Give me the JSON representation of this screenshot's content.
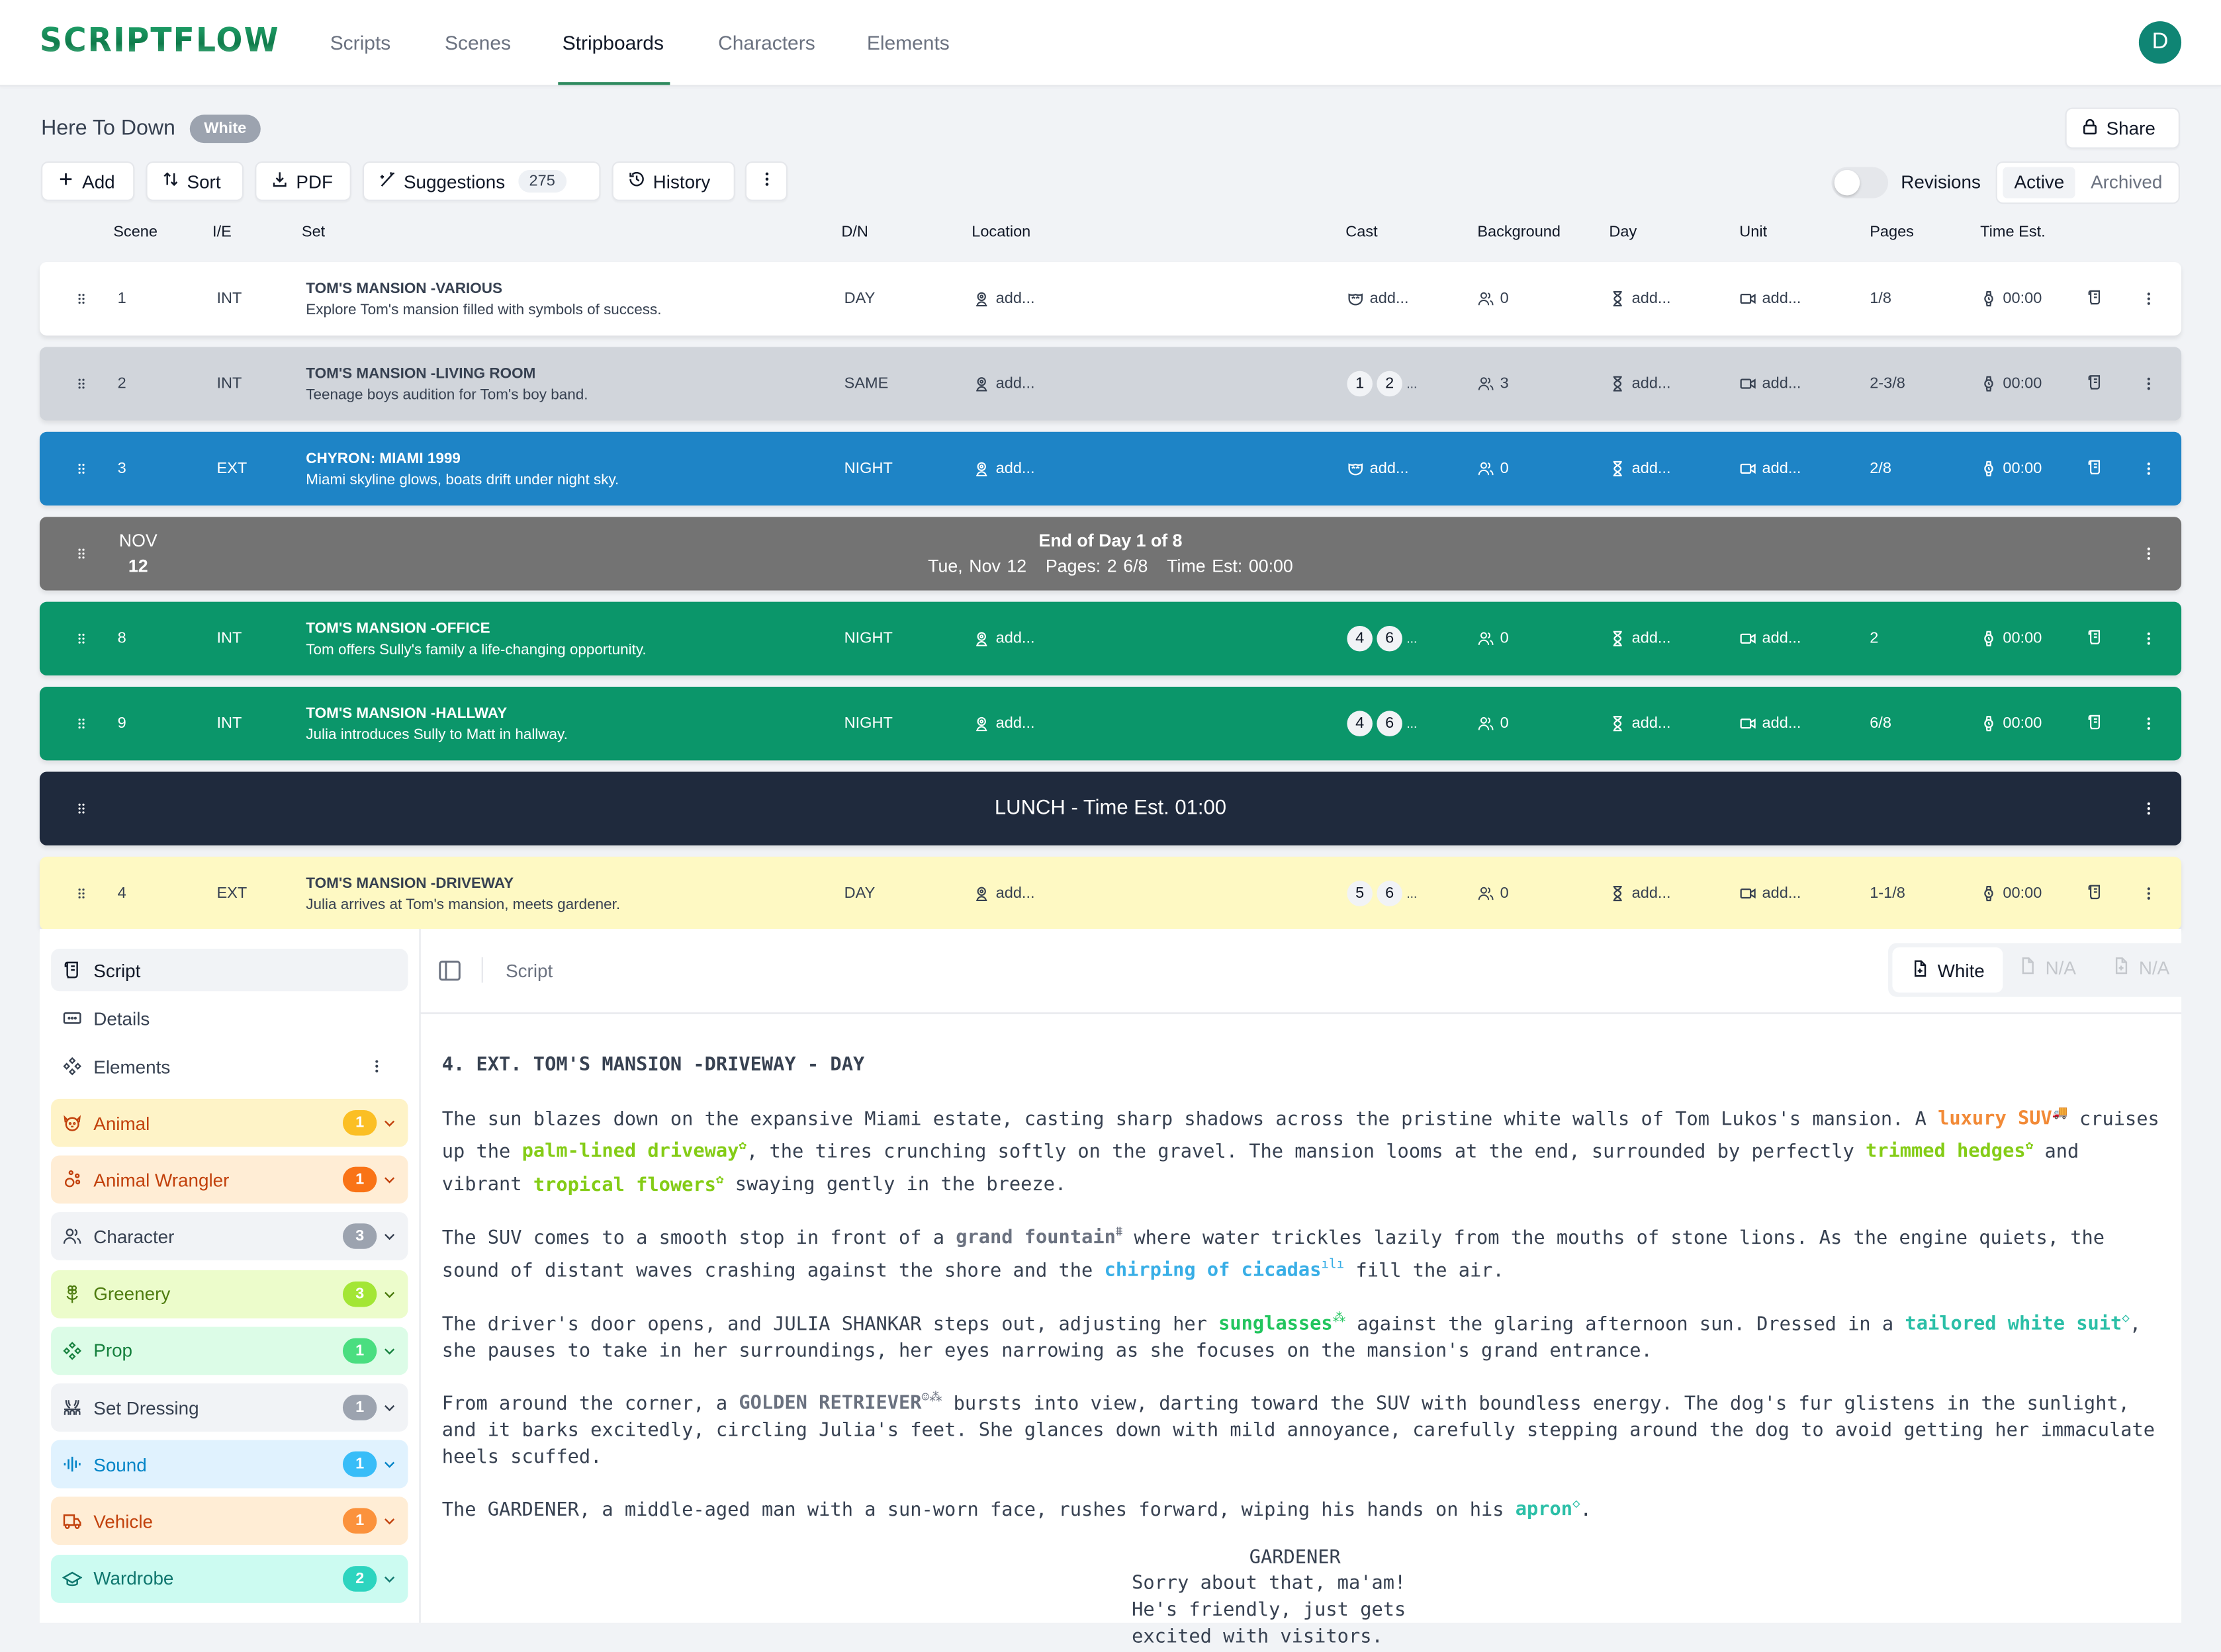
{
  "app": {
    "logo": "SCRIPTFLOW",
    "nav": [
      "Scripts",
      "Scenes",
      "Stripboards",
      "Characters",
      "Elements"
    ],
    "active_nav": "Stripboards",
    "avatar_initial": "D"
  },
  "header": {
    "title": "Here To Down",
    "revision_badge": "White",
    "share_label": "Share",
    "toolbar": {
      "add": "Add",
      "sort": "Sort",
      "pdf": "PDF",
      "suggestions": "Suggestions",
      "suggestions_count": "275",
      "history": "History"
    },
    "revisions_label": "Revisions",
    "revisions_on": false,
    "view_options": [
      "Active",
      "Archived"
    ],
    "active_view": "Active"
  },
  "table": {
    "columns": [
      "Scene",
      "I/E",
      "Set",
      "D/N",
      "Location",
      "Cast",
      "Background",
      "Day",
      "Unit",
      "Pages",
      "Time Est."
    ],
    "rows": [
      {
        "type": "scene",
        "scene": "1",
        "ie": "INT",
        "set": "TOM'S MANSION -VARIOUS",
        "desc": "Explore Tom's mansion filled with symbols of success.",
        "dn": "DAY",
        "location": "add...",
        "cast": [],
        "cast_placeholder": "add...",
        "background": "0",
        "day": "add...",
        "unit": "add...",
        "pages": "1/8",
        "time": "00:00",
        "color": "#ffffff",
        "text": "#374151"
      },
      {
        "type": "scene",
        "scene": "2",
        "ie": "INT",
        "set": "TOM'S MANSION -LIVING ROOM",
        "desc": "Teenage boys audition for Tom's boy band.",
        "dn": "SAME",
        "location": "add...",
        "cast": [
          "1",
          "2"
        ],
        "cast_more": "...",
        "background": "3",
        "day": "add...",
        "unit": "add...",
        "pages": "2-3/8",
        "time": "00:00",
        "color": "#d1d5db",
        "text": "#374151"
      },
      {
        "type": "scene",
        "scene": "3",
        "ie": "EXT",
        "set": "CHYRON: MIAMI 1999",
        "desc": "Miami skyline glows, boats drift under night sky.",
        "dn": "NIGHT",
        "location": "add...",
        "cast": [],
        "cast_placeholder": "add...",
        "background": "0",
        "day": "add...",
        "unit": "add...",
        "pages": "2/8",
        "time": "00:00",
        "color": "#1e84c6",
        "text": "#ffffff"
      },
      {
        "type": "day_break",
        "month": "NOV",
        "day": "12",
        "title": "End of Day 1 of 8",
        "date": "Tue, Nov 12",
        "pages": "Pages: 2 6/8",
        "time": "Time Est: 00:00",
        "color": "#737373",
        "text": "#ffffff"
      },
      {
        "type": "scene",
        "scene": "8",
        "ie": "INT",
        "set": "TOM'S MANSION -OFFICE",
        "desc": "Tom offers Sully's family a life-changing opportunity.",
        "dn": "NIGHT",
        "location": "add...",
        "cast": [
          "4",
          "6"
        ],
        "cast_more": "...",
        "background": "0",
        "day": "add...",
        "unit": "add...",
        "pages": "2",
        "time": "00:00",
        "color": "#0b966a",
        "text": "#ffffff"
      },
      {
        "type": "scene",
        "scene": "9",
        "ie": "INT",
        "set": "TOM'S MANSION -HALLWAY",
        "desc": "Julia introduces Sully to Matt in hallway.",
        "dn": "NIGHT",
        "location": "add...",
        "cast": [
          "4",
          "6"
        ],
        "cast_more": "...",
        "background": "0",
        "day": "add...",
        "unit": "add...",
        "pages": "6/8",
        "time": "00:00",
        "color": "#0b966a",
        "text": "#ffffff"
      },
      {
        "type": "banner",
        "title": "LUNCH - Time Est. 01:00",
        "color": "#1f2a3d",
        "text": "#ffffff"
      },
      {
        "type": "scene",
        "scene": "4",
        "ie": "EXT",
        "set": "TOM'S MANSION -DRIVEWAY",
        "desc": "Julia arrives at Tom's mansion, meets gardener.",
        "dn": "DAY",
        "location": "add...",
        "cast": [
          "5",
          "6"
        ],
        "cast_more": "...",
        "background": "0",
        "day": "add...",
        "unit": "add...",
        "pages": "1-1/8",
        "time": "00:00",
        "color": "#fef9c3",
        "text": "#374151"
      }
    ]
  },
  "sidebar": {
    "nav": [
      {
        "label": "Script",
        "icon": "script-icon",
        "active": true
      },
      {
        "label": "Details",
        "icon": "details-icon",
        "active": false
      },
      {
        "label": "Elements",
        "icon": "elements-icon",
        "active": false
      }
    ],
    "categories": [
      {
        "label": "Animal",
        "count": "1",
        "icon": "animal-icon",
        "bg": "#fef3c7",
        "fg": "#c2410c",
        "badge": "#fbbf24"
      },
      {
        "label": "Animal Wrangler",
        "count": "1",
        "icon": "paw-icon",
        "bg": "#ffedd5",
        "fg": "#c2410c",
        "badge": "#f97316"
      },
      {
        "label": "Character",
        "count": "3",
        "icon": "users-icon",
        "bg": "#f1f3f6",
        "fg": "#374151",
        "badge": "#9ca3af"
      },
      {
        "label": "Greenery",
        "count": "3",
        "icon": "flower-icon",
        "bg": "#ecfccb",
        "fg": "#4d7c0f",
        "badge": "#a3e635"
      },
      {
        "label": "Prop",
        "count": "1",
        "icon": "prop-icon",
        "bg": "#dcfce7",
        "fg": "#15803d",
        "badge": "#4ade80"
      },
      {
        "label": "Set Dressing",
        "count": "1",
        "icon": "curtains-icon",
        "bg": "#f1f3f6",
        "fg": "#374151",
        "badge": "#9ca3af"
      },
      {
        "label": "Sound",
        "count": "1",
        "icon": "audio-icon",
        "bg": "#e0f2fe",
        "fg": "#0284c7",
        "badge": "#38bdf8"
      },
      {
        "label": "Vehicle",
        "count": "1",
        "icon": "truck-icon",
        "bg": "#ffedd5",
        "fg": "#c2410c",
        "badge": "#fb923c"
      },
      {
        "label": "Wardrobe",
        "count": "2",
        "icon": "shirt-icon",
        "bg": "#ccfbf1",
        "fg": "#0f766e",
        "badge": "#2dd4bf"
      }
    ]
  },
  "script": {
    "breadcrumb": "Script",
    "revisions": [
      {
        "label": "White",
        "active": true
      },
      {
        "label": "N/A",
        "active": false
      },
      {
        "label": "N/A",
        "active": false
      }
    ],
    "heading": "4. EXT. TOM'S MANSION -DRIVEWAY - DAY",
    "paragraphs": [
      [
        {
          "t": "The sun blazes down on the expansive Miami estate, casting sharp shadows across the pristine white walls of Tom Lukos's mansion. A "
        },
        {
          "t": "luxury SUV",
          "el": "Vehicle",
          "color": "#f28a37",
          "icon": "🚚"
        },
        {
          "t": " cruises up the "
        },
        {
          "t": "palm-lined driveway",
          "el": "Greenery",
          "color": "#84cc16",
          "icon": "✿"
        },
        {
          "t": ", the tires crunching softly on the gravel. The mansion looms at the end, surrounded by perfectly "
        },
        {
          "t": "trimmed hedges",
          "el": "Greenery",
          "color": "#84cc16",
          "icon": "✿"
        },
        {
          "t": " and vibrant "
        },
        {
          "t": "tropical flowers",
          "el": "Greenery",
          "color": "#84cc16",
          "icon": "✿"
        },
        {
          "t": " swaying gently in the breeze."
        }
      ],
      [
        {
          "t": "The SUV comes to a smooth stop in front of a "
        },
        {
          "t": "grand fountain",
          "el": "Set Dressing",
          "color": "#6b7280",
          "icon": "⩩"
        },
        {
          "t": " where water trickles lazily from the mouths of stone lions. As the engine quiets, the sound of distant waves crashing against the shore and the "
        },
        {
          "t": "chirping of cicadas",
          "el": "Sound",
          "color": "#38aee6",
          "icon": "ılı"
        },
        {
          "t": " fill the air."
        }
      ],
      [
        {
          "t": "The driver's door opens, and JULIA SHANKAR steps out, adjusting her "
        },
        {
          "t": "sunglasses",
          "el": "Prop",
          "color": "#22c55e",
          "icon": "⁂"
        },
        {
          "t": " against the glaring afternoon sun. Dressed in a "
        },
        {
          "t": "tailored white suit",
          "el": "Wardrobe",
          "color": "#2bbfa7",
          "icon": "◇"
        },
        {
          "t": ", she pauses to take in her surroundings, her eyes narrowing as she focuses on the mansion's grand entrance."
        }
      ],
      [
        {
          "t": "From around the corner, a "
        },
        {
          "t": "GOLDEN RETRIEVER",
          "el": "Character",
          "color": "#6b7280",
          "icon": "☺⁂"
        },
        {
          "t": " bursts into view, darting toward the SUV with boundless energy. The dog's fur glistens in the sunlight, and it barks excitedly, circling Julia's feet. She glances down with mild annoyance, carefully stepping around the dog to avoid getting her immaculate heels scuffed."
        }
      ],
      [
        {
          "t": "The GARDENER, a middle-aged man with a sun-worn face, rushes forward, wiping his hands on his "
        },
        {
          "t": "apron",
          "el": "Wardrobe",
          "color": "#2bbfa7",
          "icon": "◇"
        },
        {
          "t": "."
        }
      ]
    ],
    "dialogue": {
      "character": "GARDENER",
      "lines": [
        "Sorry about that, ma'am!",
        "He's friendly, just gets",
        "excited with visitors."
      ]
    }
  }
}
